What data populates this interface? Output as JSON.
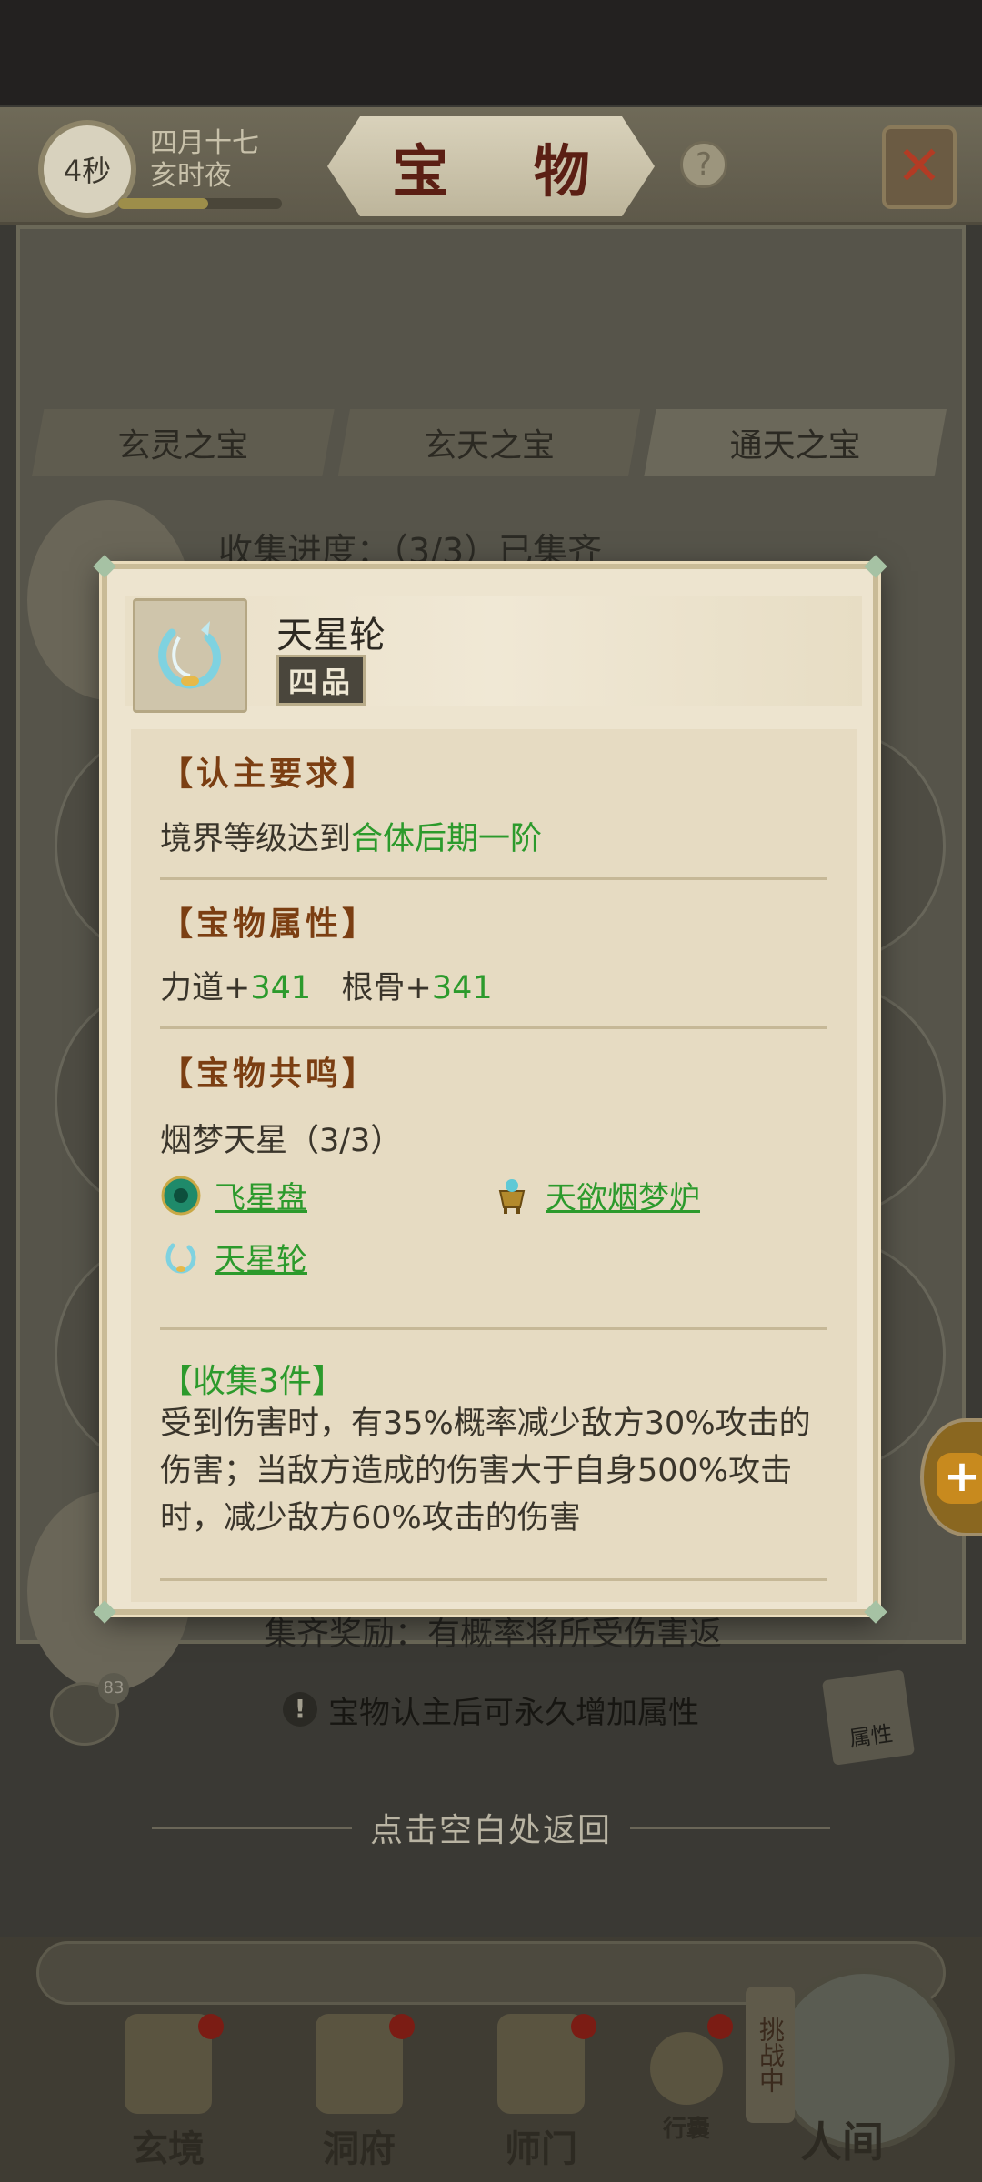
{
  "header": {
    "timer": "4秒",
    "date_line1": "四月十七",
    "date_line2": "亥时夜",
    "title": "宝 物",
    "help_icon": "question-icon",
    "close_icon": "crossed-swords-close-icon"
  },
  "tabs": [
    {
      "label": "玄灵之宝"
    },
    {
      "label": "玄天之宝"
    },
    {
      "label": "通天之宝",
      "active": true
    }
  ],
  "background": {
    "collect_progress": "收集进度：（3/3）已集齐",
    "reward_text": "集齐奖励：有概率将所受伤害返"
  },
  "popup": {
    "item_name": "天星轮",
    "grade": "四品",
    "requirement": {
      "title": "【认主要求】",
      "prefix": "境界等级达到",
      "value": "合体后期一阶"
    },
    "attributes": {
      "title": "【宝物属性】",
      "attr1_name": "力道+",
      "attr1_value": "341",
      "attr2_name": "根骨+",
      "attr2_value": "341"
    },
    "resonance": {
      "title": "【宝物共鸣】",
      "set_name": "烟梦天星（3/3）",
      "items": [
        {
          "name": "飞星盘",
          "icon": "jade-disc-icon"
        },
        {
          "name": "天欲烟梦炉",
          "icon": "incense-burner-icon"
        },
        {
          "name": "天星轮",
          "icon": "star-wheel-icon"
        }
      ]
    },
    "collect_bonus": {
      "title": "【收集3件】",
      "text": "受到伤害时，有35%概率减少敌方30%攻击的伤害；当敌方造成的伤害大于自身500%攻击时，减少敌方60%攻击的伤害"
    }
  },
  "hint": {
    "text": "宝物认主后可永久增加属性",
    "chat_count": "83",
    "attr_label": "属性"
  },
  "return_text": "点击空白处返回",
  "nav": {
    "items": [
      {
        "label": "玄境"
      },
      {
        "label": "洞府"
      },
      {
        "label": "师门"
      },
      {
        "label": "行囊"
      }
    ],
    "challenge": "挑战中",
    "human": "人间"
  },
  "colors": {
    "green_value": "#2c9a2c",
    "section_title": "#7b3e12",
    "popup_bg": "#ede4cf"
  }
}
